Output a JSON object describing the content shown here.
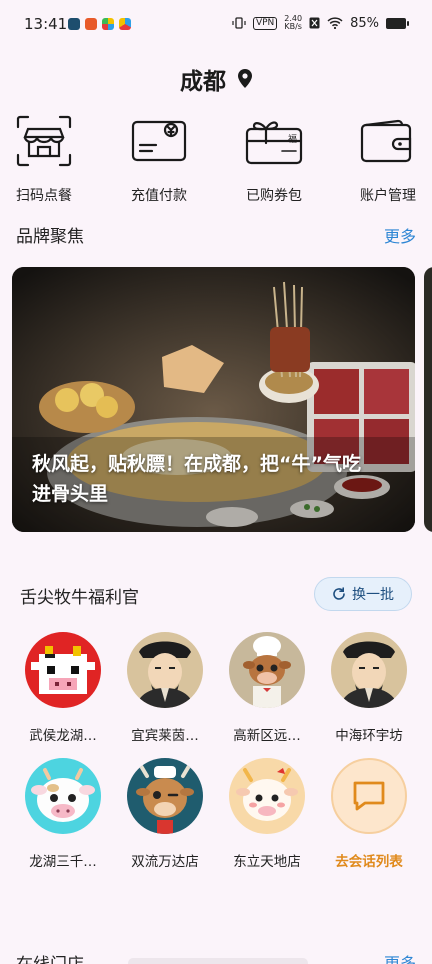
{
  "status": {
    "time": "13:41",
    "vpn": "VPN",
    "speed_value": "2.40",
    "speed_unit": "KB/s",
    "battery": "85%"
  },
  "header": {
    "city": "成都"
  },
  "quick_actions": [
    {
      "label": "扫码点餐",
      "icon": "storefront-scan-icon"
    },
    {
      "label": "充值付款",
      "icon": "card-payment-icon"
    },
    {
      "label": "已购券包",
      "icon": "gift-coupon-icon"
    },
    {
      "label": "账户管理",
      "icon": "wallet-icon"
    }
  ],
  "brand": {
    "title": "品牌聚焦",
    "more": "更多"
  },
  "banner": {
    "caption": "秋风起，贴秋膘！在成都，把“牛”气吃进骨头里"
  },
  "welfare": {
    "title": "舌尖牧牛福利官",
    "refresh_label": "换一批",
    "stores": [
      {
        "name": "武侯龙湖…",
        "avatar": "pixel-cow-avatar"
      },
      {
        "name": "宜宾莱茵…",
        "avatar": "scholar-avatar"
      },
      {
        "name": "高新区远…",
        "avatar": "chef-cow-avatar"
      },
      {
        "name": "中海环宇坊",
        "avatar": "scholar-avatar"
      },
      {
        "name": "龙湖三千…",
        "avatar": "cute-cow-avatar"
      },
      {
        "name": "双流万达店",
        "avatar": "winking-cow-avatar"
      },
      {
        "name": "东立天地店",
        "avatar": "blushing-cow-avatar"
      },
      {
        "name": "去会话列表",
        "avatar": "chat-icon"
      }
    ]
  },
  "online": {
    "title": "在线门店",
    "more": "更多"
  },
  "colors": {
    "accent_blue": "#2e86d4",
    "orange": "#e08a1c",
    "background": "#fbf4fa"
  }
}
